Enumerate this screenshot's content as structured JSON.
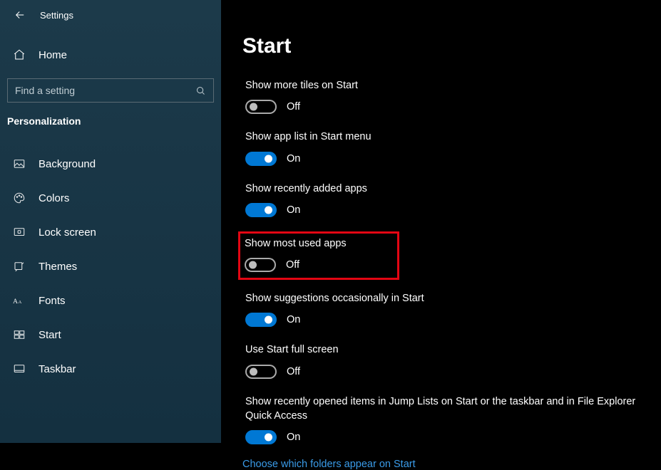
{
  "header": {
    "title": "Settings"
  },
  "sidebar": {
    "home_label": "Home",
    "search_placeholder": "Find a setting",
    "category": "Personalization",
    "items": [
      {
        "label": "Background"
      },
      {
        "label": "Colors"
      },
      {
        "label": "Lock screen"
      },
      {
        "label": "Themes"
      },
      {
        "label": "Fonts"
      },
      {
        "label": "Start"
      },
      {
        "label": "Taskbar"
      }
    ]
  },
  "main": {
    "title": "Start",
    "settings": [
      {
        "label": "Show more tiles on Start",
        "state_label": "Off",
        "on": false
      },
      {
        "label": "Show app list in Start menu",
        "state_label": "On",
        "on": true
      },
      {
        "label": "Show recently added apps",
        "state_label": "On",
        "on": true
      },
      {
        "label": "Show most used apps",
        "state_label": "Off",
        "on": false,
        "highlighted": true
      },
      {
        "label": "Show suggestions occasionally in Start",
        "state_label": "On",
        "on": true
      },
      {
        "label": "Use Start full screen",
        "state_label": "Off",
        "on": false
      },
      {
        "label": "Show recently opened items in Jump Lists on Start or the taskbar and in File Explorer Quick Access",
        "state_label": "On",
        "on": true
      }
    ],
    "link": "Choose which folders appear on Start"
  }
}
